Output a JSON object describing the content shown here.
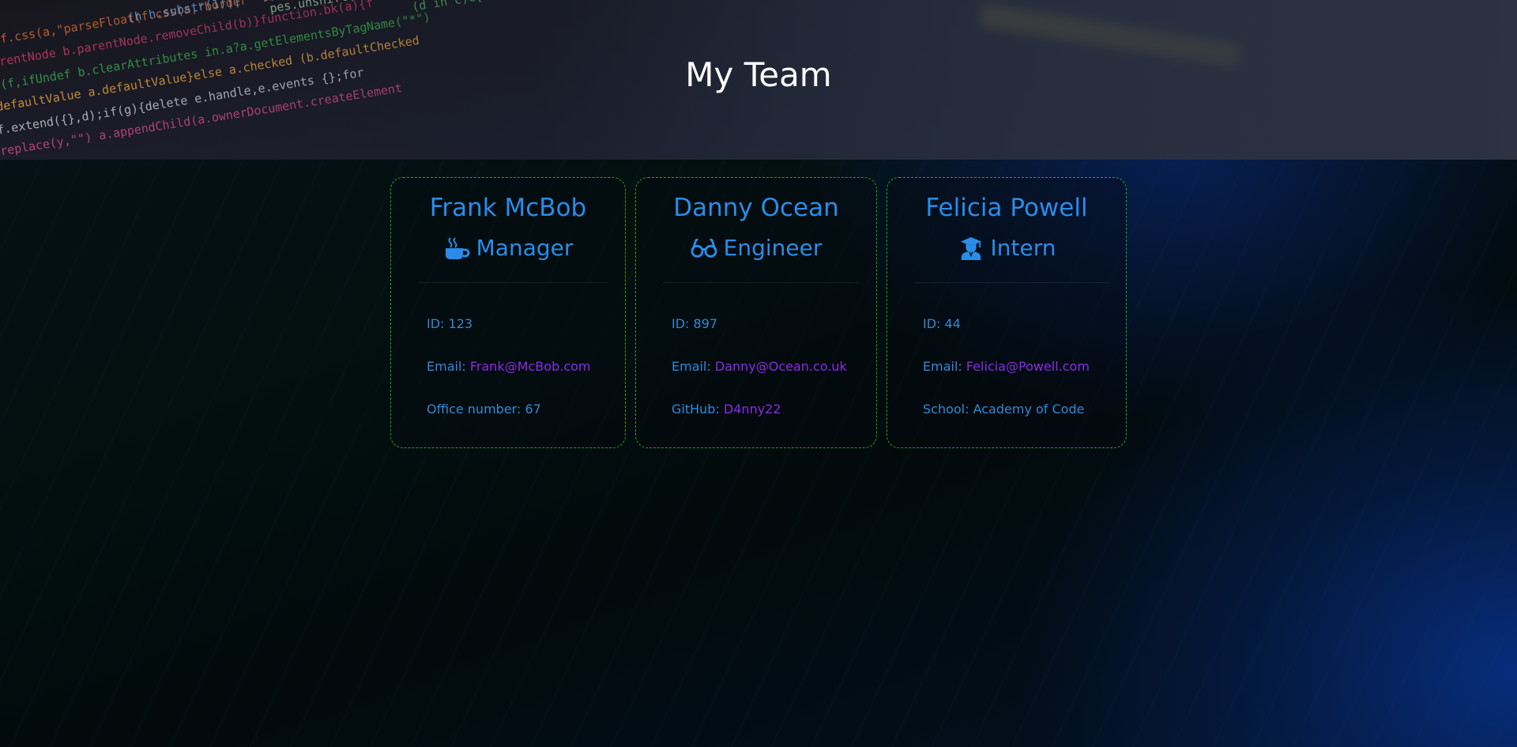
{
  "header": {
    "title": "My Team"
  },
  "team": [
    {
      "name": "Frank McBob",
      "role": "Manager",
      "icon": "coffee-icon",
      "id_label": "ID: ",
      "id": "123",
      "email_label": "Email: ",
      "email": "Frank@McBob.com",
      "extra_label": "Office number: ",
      "extra_value": "67"
    },
    {
      "name": "Danny Ocean",
      "role": "Engineer",
      "icon": "glasses-icon",
      "id_label": "ID: ",
      "id": "897",
      "email_label": "Email: ",
      "email": "Danny@Ocean.co.uk",
      "extra_label": "GitHub: ",
      "extra_value": "D4nny22"
    },
    {
      "name": "Felicia Powell",
      "role": "Intern",
      "icon": "graduate-icon",
      "id_label": "ID: ",
      "id": "44",
      "email_label": "Email: ",
      "email": "Felicia@Powell.com",
      "extra_label": "School: ",
      "extra_value": "Academy of Code"
    }
  ],
  "colors": {
    "accent": "#2a8ce8",
    "link": "#8a2be2",
    "card_border": "#18a820",
    "title": "#ffffff"
  }
}
